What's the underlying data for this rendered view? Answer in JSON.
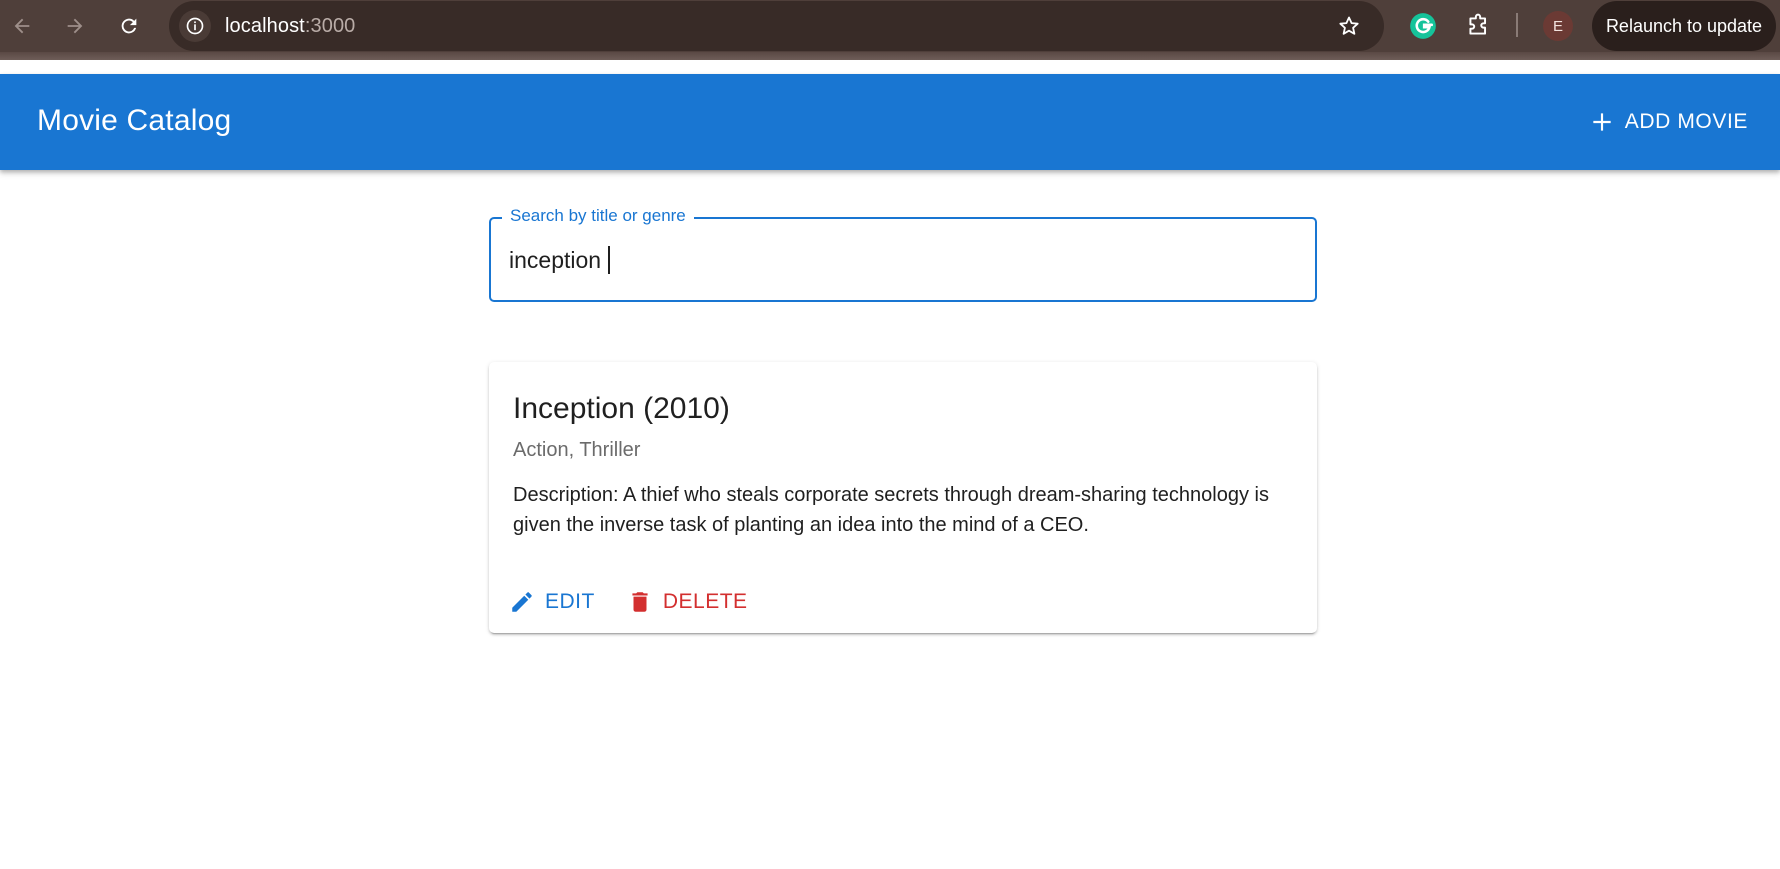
{
  "browser": {
    "url_host": "localhost",
    "url_port": ":3000",
    "profile_initial": "E",
    "relaunch_label": "Relaunch to update",
    "icons": [
      "back-icon",
      "forward-icon",
      "reload-icon",
      "site-info-icon",
      "star-icon",
      "grammarly-icon",
      "extensions-icon"
    ]
  },
  "appbar": {
    "title": "Movie Catalog",
    "add_label": "ADD MOVIE",
    "color": "#1976d2"
  },
  "search": {
    "label": "Search by title or genre",
    "value": "inception"
  },
  "movies": [
    {
      "title": "Inception (2010)",
      "genres": "Action, Thriller",
      "description": "Description: A thief who steals corporate secrets through dream-sharing technology is given the inverse task of planting an idea into the mind of a CEO.",
      "edit_label": "EDIT",
      "delete_label": "DELETE"
    }
  ],
  "colors": {
    "primary": "#1976d2",
    "danger": "#d32f2f",
    "chrome": "#4f3f3a"
  }
}
